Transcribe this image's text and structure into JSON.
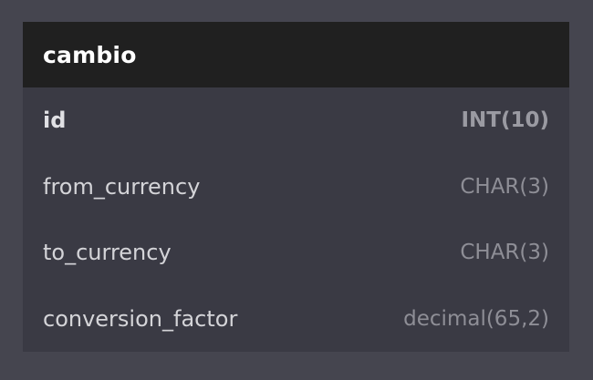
{
  "table": {
    "name": "cambio",
    "columns": [
      {
        "name": "id",
        "type": "INT(10)",
        "primary_key": true
      },
      {
        "name": "from_currency",
        "type": "CHAR(3)",
        "primary_key": false
      },
      {
        "name": "to_currency",
        "type": "CHAR(3)",
        "primary_key": false
      },
      {
        "name": "conversion_factor",
        "type": "decimal(65,2)",
        "primary_key": false
      }
    ]
  }
}
